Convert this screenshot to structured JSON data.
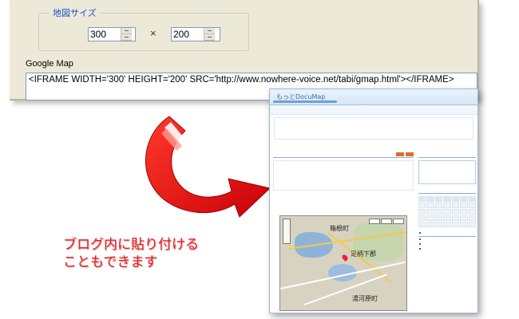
{
  "dialog": {
    "group_label": "地図サイズ",
    "width_value": "300",
    "height_value": "200",
    "times_sign": "×",
    "field_label": "Google Map",
    "embed_code": "<IFRAME WIDTH='300' HEIGHT='200' SRC='http://www.nowhere-voice.net/tabi/gmap.html'></IFRAME>"
  },
  "blog": {
    "title": "もっとDocuMap",
    "map_labels": [
      "箱根町",
      "足柄下郡",
      "湯河原町"
    ]
  },
  "caption": "ブログ内に貼り付ける\nこともできます",
  "colors": {
    "arrow": "#e8000a",
    "caption": "#f01818",
    "dialog_bg": "#ece9d8",
    "legend": "#1a4fc8"
  }
}
